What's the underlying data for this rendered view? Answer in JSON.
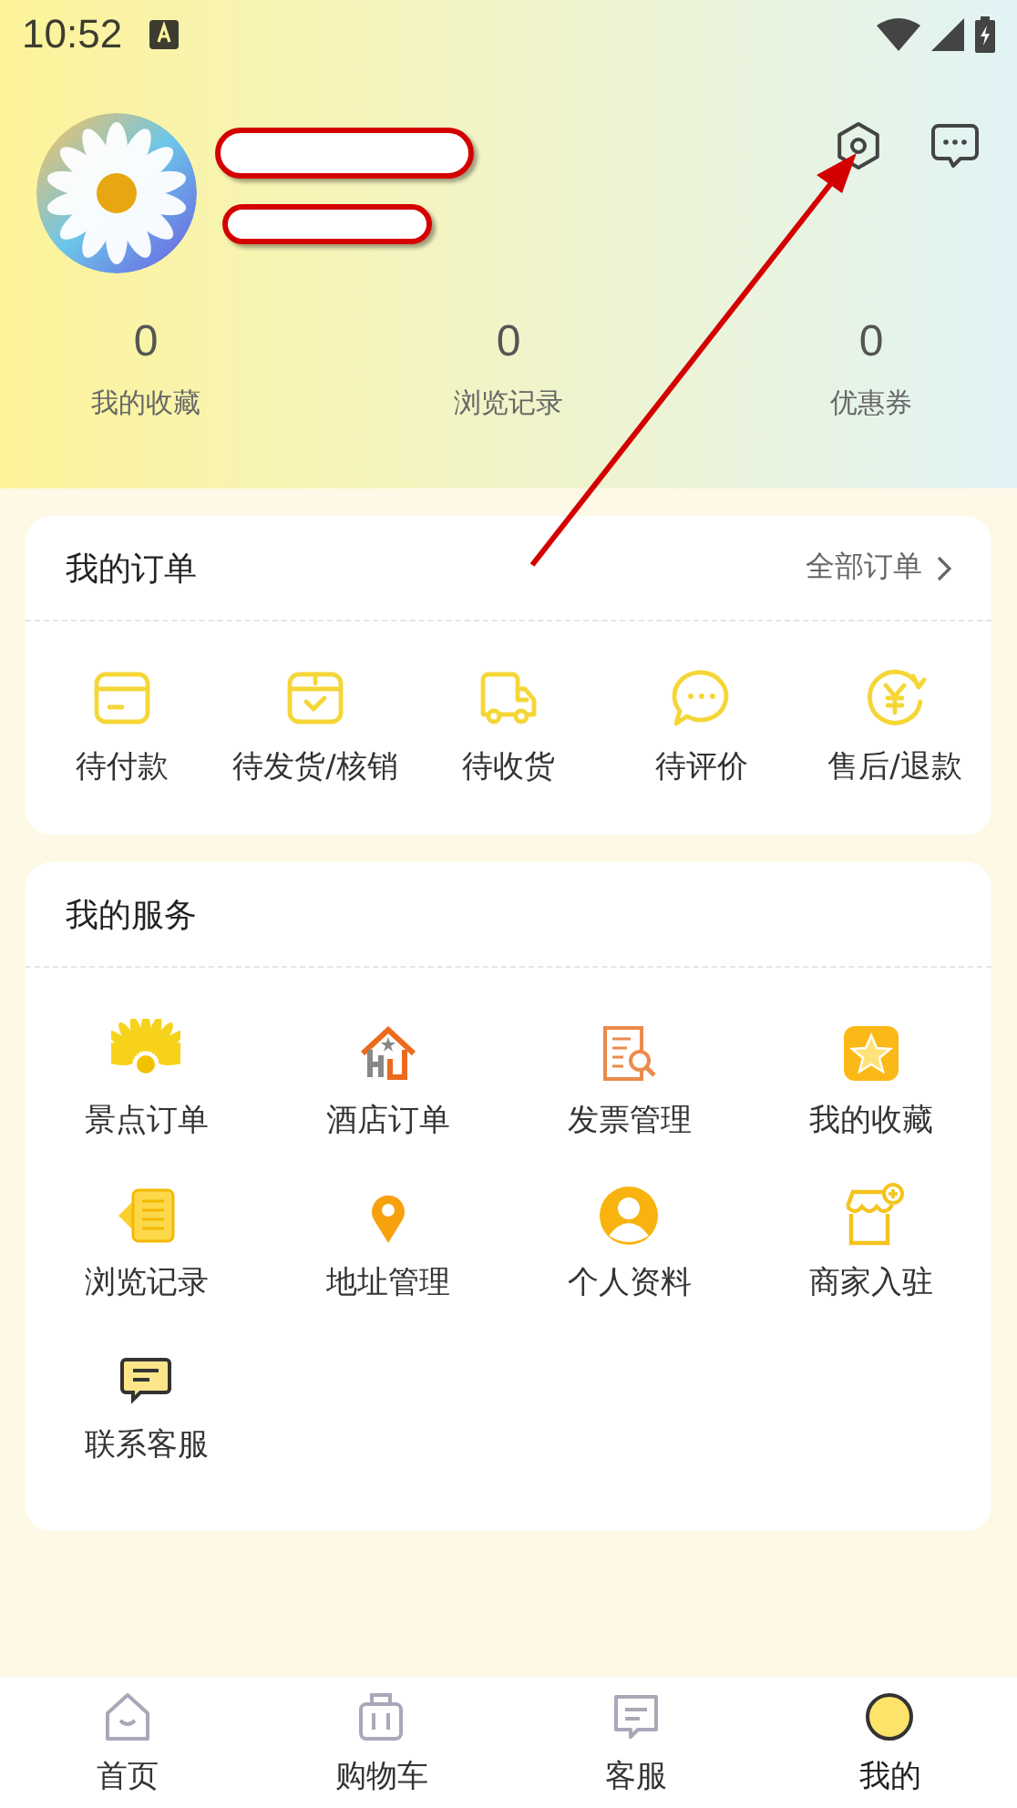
{
  "status_bar": {
    "time": "10:52"
  },
  "stats": [
    {
      "value": "0",
      "label": "我的收藏"
    },
    {
      "value": "0",
      "label": "浏览记录"
    },
    {
      "value": "0",
      "label": "优惠券"
    }
  ],
  "orders": {
    "title": "我的订单",
    "link": "全部订单",
    "items": [
      "待付款",
      "待发货/核销",
      "待收货",
      "待评价",
      "售后/退款"
    ]
  },
  "services": {
    "title": "我的服务",
    "items": [
      "景点订单",
      "酒店订单",
      "发票管理",
      "我的收藏",
      "浏览记录",
      "地址管理",
      "个人资料",
      "商家入驻",
      "联系客服"
    ]
  },
  "bottom_nav": [
    {
      "label": "首页",
      "selected": false
    },
    {
      "label": "购物车",
      "selected": false
    },
    {
      "label": "客服",
      "selected": false
    },
    {
      "label": "我的",
      "selected": true
    }
  ]
}
